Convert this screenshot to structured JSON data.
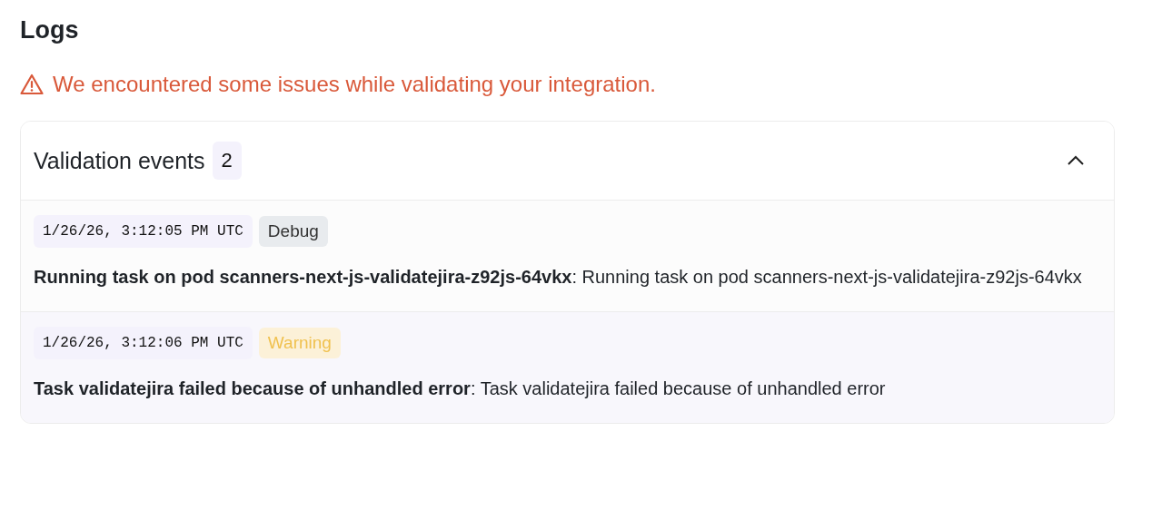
{
  "title": "Logs",
  "alert": {
    "text": "We encountered some issues while validating your integration."
  },
  "panel": {
    "title": "Validation events",
    "count": "2",
    "expanded": true,
    "events": [
      {
        "timestamp": "1/26/26, 3:12:05 PM UTC",
        "level": "Debug",
        "kind": "debug",
        "highlighted": false,
        "message": "**Running task on pod scanners-next-js-validatejira-z92js-64vkx**: Running task on pod scanners-next-js-validatejira-z92js-64vkx"
      },
      {
        "timestamp": "1/26/26, 3:12:06 PM UTC",
        "level": "Warning",
        "kind": "warning",
        "highlighted": true,
        "message": "**Task validatejira failed because of unhandled error**: Task validatejira failed because of unhandled error"
      }
    ]
  }
}
